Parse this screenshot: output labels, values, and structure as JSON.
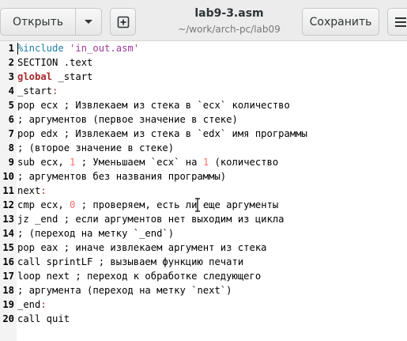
{
  "header": {
    "open_label": "Открыть",
    "open_accel": "О",
    "save_label": "Сохранить",
    "save_accel": "х",
    "title": "lab9-3.asm",
    "subtitle": "~/work/arch-pc/lab09"
  },
  "lines": [
    {
      "n": "1",
      "segs": [
        {
          "t": "%include",
          "c": "pre"
        },
        {
          "t": " ",
          "c": ""
        },
        {
          "t": "'in_out.asm'",
          "c": "str"
        }
      ]
    },
    {
      "n": "2",
      "segs": [
        {
          "t": "SECTION .text",
          "c": ""
        }
      ]
    },
    {
      "n": "3",
      "segs": [
        {
          "t": "global",
          "c": "kw"
        },
        {
          "t": " _start",
          "c": ""
        }
      ]
    },
    {
      "n": "4",
      "segs": [
        {
          "t": "_start",
          "c": ""
        },
        {
          "t": ":",
          "c": "lbl"
        }
      ]
    },
    {
      "n": "5",
      "segs": [
        {
          "t": "pop ecx ; Извлекаем из стека в `ecx` количество",
          "c": ""
        }
      ]
    },
    {
      "n": "6",
      "segs": [
        {
          "t": "; аргументов (первое значение в стеке)",
          "c": ""
        }
      ]
    },
    {
      "n": "7",
      "segs": [
        {
          "t": "pop edx ; Извлекаем из стека в `edx` имя программы",
          "c": ""
        }
      ]
    },
    {
      "n": "8",
      "segs": [
        {
          "t": "; (второе значение в стеке)",
          "c": ""
        }
      ]
    },
    {
      "n": "9",
      "segs": [
        {
          "t": "sub ecx, ",
          "c": ""
        },
        {
          "t": "1",
          "c": "num"
        },
        {
          "t": " ; Уменьшаем `ecx` на ",
          "c": ""
        },
        {
          "t": "1",
          "c": "num"
        },
        {
          "t": " (количество",
          "c": ""
        }
      ]
    },
    {
      "n": "10",
      "segs": [
        {
          "t": "; аргументов без названия программы)",
          "c": ""
        }
      ]
    },
    {
      "n": "11",
      "segs": [
        {
          "t": "next",
          "c": ""
        },
        {
          "t": ":",
          "c": "lbl"
        }
      ]
    },
    {
      "n": "12",
      "segs": [
        {
          "t": "cmp ecx, ",
          "c": ""
        },
        {
          "t": "0",
          "c": "num"
        },
        {
          "t": " ; проверяем, есть ли еще аргументы",
          "c": ""
        }
      ]
    },
    {
      "n": "13",
      "segs": [
        {
          "t": "jz _end ; если аргументов нет выходим из цикла",
          "c": ""
        }
      ]
    },
    {
      "n": "14",
      "segs": [
        {
          "t": "; (переход на метку `_end`)",
          "c": ""
        }
      ]
    },
    {
      "n": "15",
      "segs": [
        {
          "t": "pop eax ; иначе извлекаем аргумент из стека",
          "c": ""
        }
      ]
    },
    {
      "n": "16",
      "segs": [
        {
          "t": "call sprintLF ; вызываем функцию печати",
          "c": ""
        }
      ]
    },
    {
      "n": "17",
      "segs": [
        {
          "t": "loop next ; переход к обработке следующего",
          "c": ""
        }
      ]
    },
    {
      "n": "18",
      "segs": [
        {
          "t": "; аргумента (переход на метку `next`)",
          "c": ""
        }
      ]
    },
    {
      "n": "19",
      "segs": [
        {
          "t": "_end",
          "c": ""
        },
        {
          "t": ":",
          "c": "lbl"
        }
      ]
    },
    {
      "n": "20",
      "segs": [
        {
          "t": "call quit",
          "c": ""
        }
      ]
    }
  ]
}
